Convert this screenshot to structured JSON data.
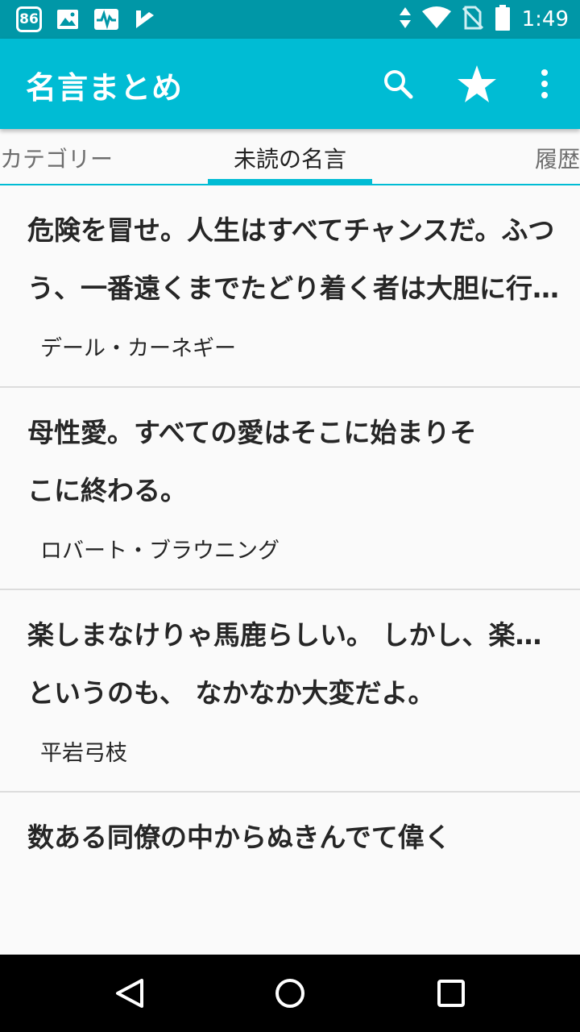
{
  "status_bar": {
    "notification_badge": "86",
    "icons": [
      "notification-count-icon",
      "image-icon",
      "activity-icon",
      "check-icon",
      "data-arrows-icon",
      "wifi-icon",
      "no-sim-icon",
      "battery-icon"
    ],
    "time": "1:49"
  },
  "toolbar": {
    "title": "名言まとめ",
    "actions": [
      "search-icon",
      "star-icon",
      "more-vert-icon"
    ]
  },
  "tabs": [
    {
      "label": "カテゴリー",
      "active": false
    },
    {
      "label": "未読の名言",
      "active": true
    },
    {
      "label": "履歴",
      "active": false
    }
  ],
  "quotes": [
    {
      "lines": [
        "危険を冒せ。人生はすべてチャンスだ。ふつ",
        "う、一番遠くまでたどり着く者は大胆に行…"
      ],
      "author": "デール・カーネギー"
    },
    {
      "lines": [
        "母性愛。すべての愛はそこに始まりそ",
        "こに終わる。"
      ],
      "author": "ロバート・ブラウニング"
    },
    {
      "lines": [
        "楽しまなけりゃ馬鹿らしい。 しかし、楽しむ",
        "というのも、 なかなか大変だよ。"
      ],
      "author": "平岩弓枝"
    },
    {
      "lines": [
        "数ある同僚の中からぬきんでて偉く",
        ""
      ],
      "author": ""
    }
  ],
  "nav_bar": {
    "buttons": [
      "back-icon",
      "home-icon",
      "recents-icon"
    ]
  },
  "colors": {
    "status_bar": "#0097a7",
    "toolbar": "#00bcd4",
    "accent": "#00bcd4",
    "background": "#fafafa"
  }
}
